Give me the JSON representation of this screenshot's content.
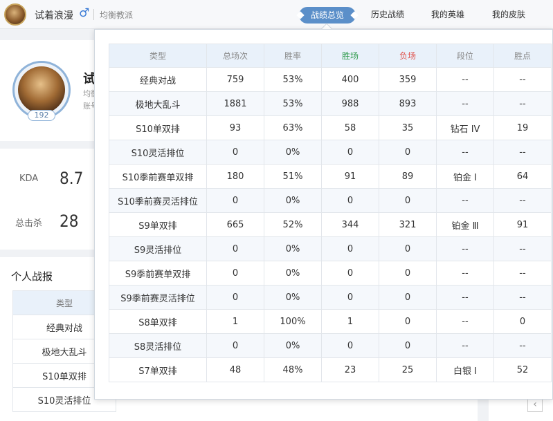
{
  "header": {
    "name": "试着浪漫",
    "gender_symbol": "♂",
    "tag": "均衡教派",
    "tabs": [
      {
        "label": "战绩总览",
        "active": true
      },
      {
        "label": "历史战绩",
        "active": false
      },
      {
        "label": "我的英雄",
        "active": false
      },
      {
        "label": "我的皮肤",
        "active": false
      }
    ]
  },
  "profile": {
    "level": "192",
    "name_partial": "试",
    "sub1_partial": "均衡",
    "sub2_partial": "账号"
  },
  "stats": {
    "kda_label": "KDA",
    "kda_value": "8.7",
    "kills_label": "总击杀",
    "kills_value": "28"
  },
  "section": {
    "title": "个人战报",
    "table_header": "类型",
    "rows": [
      "经典对战",
      "极地大乱斗",
      "S10单双排",
      "S10灵活排位"
    ]
  },
  "pager": {
    "prev": "‹"
  },
  "popup": {
    "columns": [
      "类型",
      "总场次",
      "胜率",
      "胜场",
      "负场",
      "段位",
      "胜点"
    ],
    "rows": [
      [
        "经典对战",
        "759",
        "53%",
        "400",
        "359",
        "--",
        "--"
      ],
      [
        "极地大乱斗",
        "1881",
        "53%",
        "988",
        "893",
        "--",
        "--"
      ],
      [
        "S10单双排",
        "93",
        "63%",
        "58",
        "35",
        "钻石 IV",
        "19"
      ],
      [
        "S10灵活排位",
        "0",
        "0%",
        "0",
        "0",
        "--",
        "--"
      ],
      [
        "S10季前赛单双排",
        "180",
        "51%",
        "91",
        "89",
        "铂金 Ⅰ",
        "64"
      ],
      [
        "S10季前赛灵活排位",
        "0",
        "0%",
        "0",
        "0",
        "--",
        "--"
      ],
      [
        "S9单双排",
        "665",
        "52%",
        "344",
        "321",
        "铂金 Ⅲ",
        "91"
      ],
      [
        "S9灵活排位",
        "0",
        "0%",
        "0",
        "0",
        "--",
        "--"
      ],
      [
        "S9季前赛单双排",
        "0",
        "0%",
        "0",
        "0",
        "--",
        "--"
      ],
      [
        "S9季前赛灵活排位",
        "0",
        "0%",
        "0",
        "0",
        "--",
        "--"
      ],
      [
        "S8单双排",
        "1",
        "100%",
        "1",
        "0",
        "--",
        "0"
      ],
      [
        "S8灵活排位",
        "0",
        "0%",
        "0",
        "0",
        "--",
        "--"
      ],
      [
        "S7单双排",
        "48",
        "48%",
        "23",
        "25",
        "白银 Ⅰ",
        "52"
      ]
    ]
  },
  "colors": {
    "accent": "#5b8fc9",
    "win": "#2f9a4c",
    "loss": "#e0514b",
    "gender": "#3a7bd5"
  }
}
